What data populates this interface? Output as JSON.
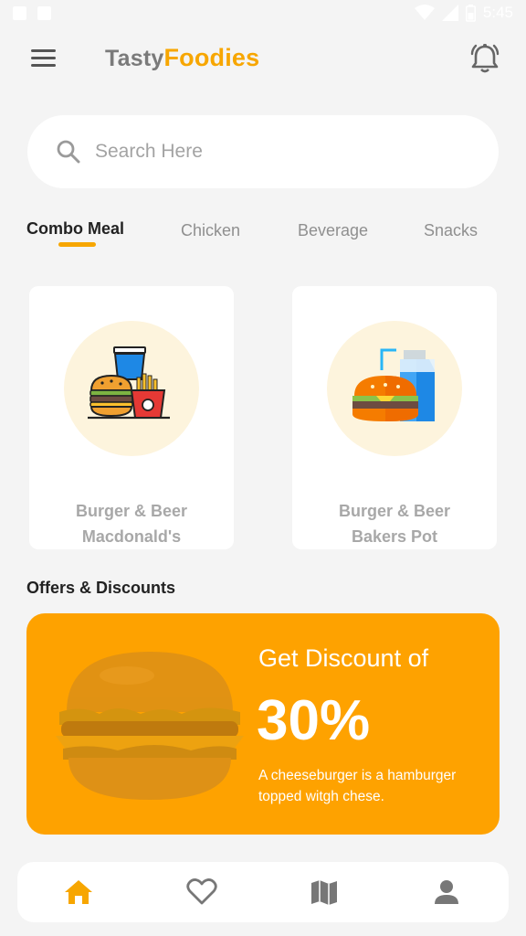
{
  "status_bar": {
    "time": "5:45"
  },
  "app": {
    "title_part1": "Tasty",
    "title_part2": "Foodies"
  },
  "search": {
    "placeholder": "Search Here",
    "value": ""
  },
  "tabs": [
    {
      "label": "Combo Meal",
      "active": true
    },
    {
      "label": "Chicken",
      "active": false
    },
    {
      "label": "Beverage",
      "active": false
    },
    {
      "label": "Snacks",
      "active": false
    }
  ],
  "cards": [
    {
      "name": "Burger & Beer",
      "store": "Macdonald's",
      "icon": "combo-meal-icon"
    },
    {
      "name": "Burger & Beer",
      "store": "Bakers Pot",
      "icon": "burger-drink-icon"
    }
  ],
  "offers": {
    "section_title": "Offers & Discounts",
    "heading": "Get Discount of",
    "percent": "30%",
    "description": "A cheeseburger is a hamburger topped witgh chese."
  },
  "bottom_nav": [
    {
      "icon": "home-icon",
      "active": true
    },
    {
      "icon": "heart-icon",
      "active": false
    },
    {
      "icon": "map-icon",
      "active": false
    },
    {
      "icon": "profile-icon",
      "active": false
    }
  ],
  "colors": {
    "accent": "#f7a600",
    "offer_bg": "#fea200",
    "background": "#f4f4f4",
    "inactive_icon": "#777777"
  }
}
